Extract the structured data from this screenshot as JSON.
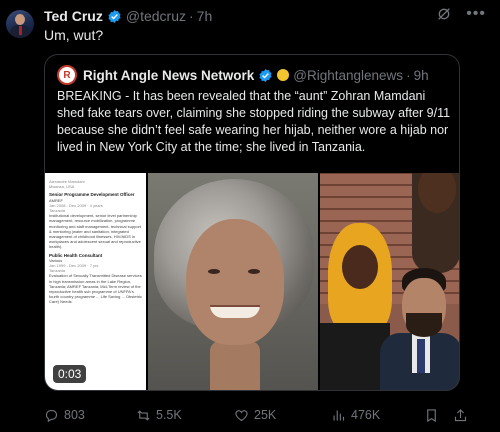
{
  "tweet": {
    "author_name": "Ted Cruz",
    "handle": "@tedcruz",
    "time": "7h",
    "text": "Um, wut?"
  },
  "quote": {
    "author_name": "Right Angle News Network",
    "handle": "@Rightanglenews",
    "time": "9h",
    "text": "BREAKING - It has been revealed that the “aunt” Zohran Mamdani shed fake tears over, claiming she stopped riding the subway after 9/11 because she didn’t feel safe wearing her hijab, neither wore a hijab nor lived in New York City at the time; she lived in Tanzania.",
    "video_duration": "0:03",
    "doc": {
      "line0": "Alexandre Mamdani",
      "line1": "Mwanza, USA",
      "title1": "Senior Programme Development Officer",
      "org1": "AMREF",
      "dates1": "Jan 2008 - Dec 2009 · 4 years",
      "loc1": "Tanzania",
      "desc1": "Institutional development, senior level partnership management, resource mobilization, programme monitoring and staff management, technical support & mentoring (water and sanitation, integrated management of childhood illnesses, HIV/AIDS in workplaces and adolescent sexual and reproductive health).",
      "title2": "Public Health Consultant",
      "org2": "Various",
      "dates2": "Jan 1999 - Dec 2009 · 7 yrs",
      "loc2": "Tanzania",
      "desc2": "Evaluation of Sexually Transmitted Disease services in high transmission areas in the Lake Region, Tanzania; AMREF Tanzania; Mid-Term review of the reproductive health sub programme of UNFPA's fourth country programme ... Life Saving ... Obstetric Care) Needs"
    }
  },
  "actions": {
    "replies": "803",
    "retweets": "5.5K",
    "likes": "25K",
    "views": "476K"
  },
  "colors": {
    "background": "#000000",
    "text": "#e7e9ea",
    "muted": "#71767b",
    "verified": "#1d9bf0",
    "border": "#2f3336"
  },
  "icons": [
    "grok-icon",
    "more-icon",
    "verified-icon",
    "reply-icon",
    "retweet-icon",
    "like-icon",
    "views-icon",
    "bookmark-icon",
    "share-icon"
  ]
}
